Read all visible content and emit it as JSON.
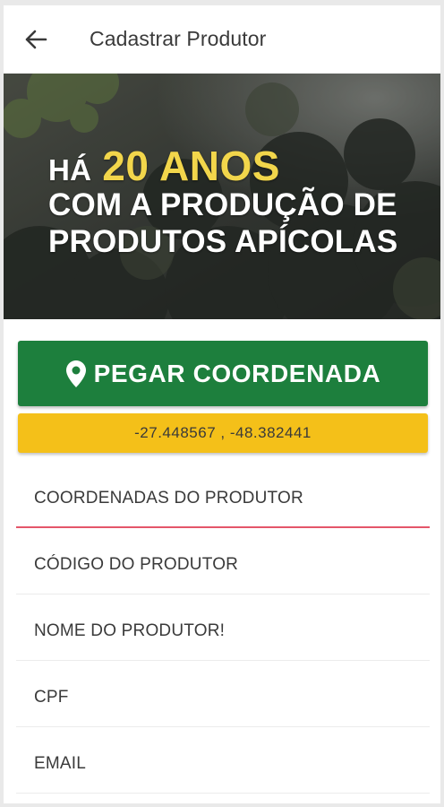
{
  "toolbar": {
    "back_icon": "arrow-left-icon",
    "title": "Cadastrar Produtor"
  },
  "hero": {
    "line1_prefix": "HÁ",
    "line1_highlight": "20 ANOS",
    "line2": "COM A PRODUÇÃO DE",
    "line3": "PRODUTOS APÍCOLAS",
    "highlight_color": "#f2d64b"
  },
  "coordinate": {
    "button_icon": "map-pin-icon",
    "button_label": "PEGAR COORDENADA",
    "button_color": "#1d7f3d",
    "value": "-27.448567 , -48.382441",
    "value_bg": "#f4c019"
  },
  "form": {
    "fields": [
      {
        "label": "COORDENADAS DO PRODUTOR",
        "active": true
      },
      {
        "label": "CÓDIGO DO PRODUTOR"
      },
      {
        "label": "NOME DO PRODUTOR!"
      },
      {
        "label": "CPF"
      },
      {
        "label": "EMAIL"
      }
    ],
    "active_underline_color": "#e4566a"
  }
}
